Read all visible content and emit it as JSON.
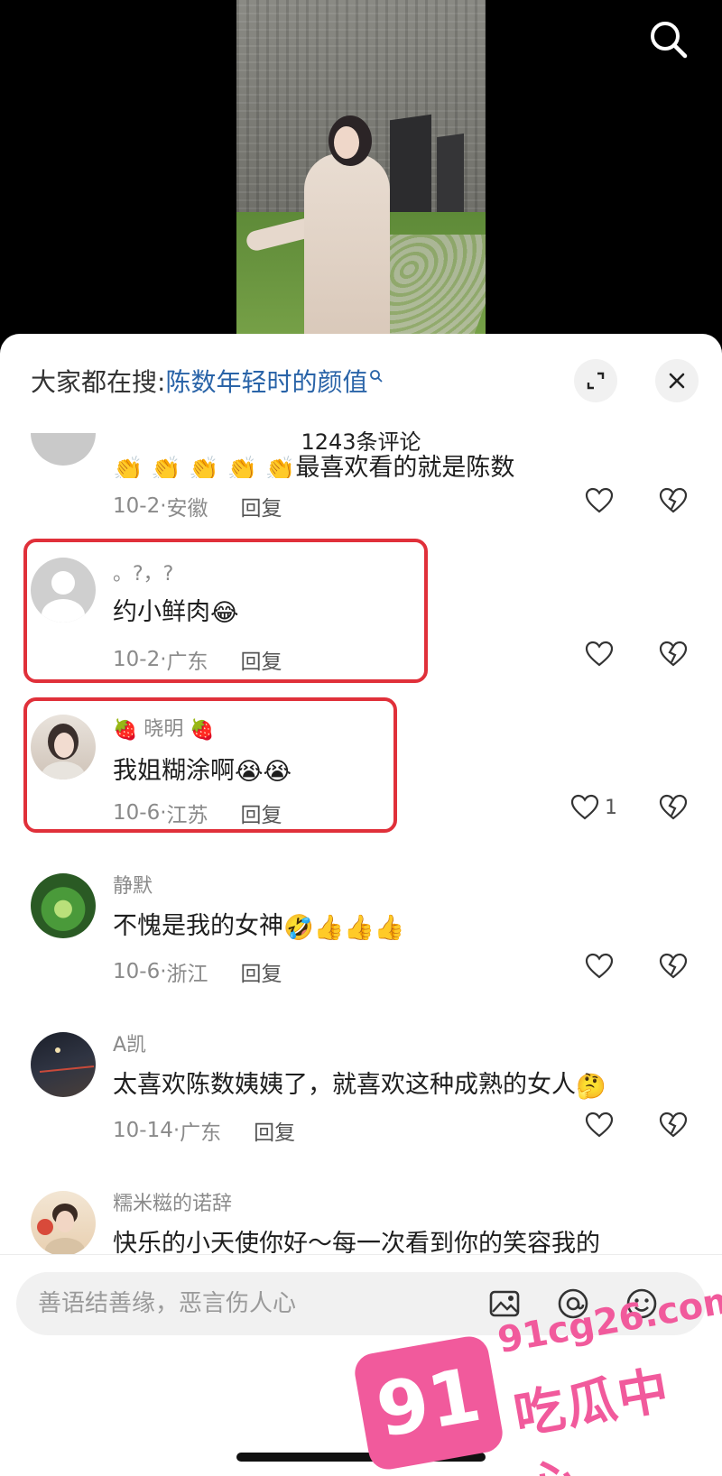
{
  "hot_search": {
    "label": "大家都在搜:",
    "query": "陈数年轻时的颜值"
  },
  "comment_count_label": "1243条评论",
  "partial_comment": {
    "text": "最喜欢看的就是陈数",
    "date": "10-2",
    "location": "安徽",
    "reply_label": "回复"
  },
  "comments": [
    {
      "username": "。?，?",
      "text": "约小鲜肉",
      "emoji": "😂",
      "date": "10-2",
      "location": "广东",
      "reply_label": "回复",
      "like_count": ""
    },
    {
      "username": "晓明",
      "username_emoji": "🍓",
      "text": "我姐糊涂啊",
      "emoji": "😭😭",
      "date": "10-6",
      "location": "江苏",
      "reply_label": "回复",
      "like_count": "1"
    },
    {
      "username": "静默",
      "text": "不愧是我的女神",
      "emoji": "🤣👍👍👍",
      "date": "10-6",
      "location": "浙江",
      "reply_label": "回复",
      "like_count": ""
    },
    {
      "username": "A凯",
      "text": "太喜欢陈数姨姨了，就喜欢这种成熟的女人",
      "emoji": "🤔",
      "date": "10-14",
      "location": "广东",
      "reply_label": "回复",
      "like_count": ""
    },
    {
      "username": "糯米糍的诺辞",
      "text": "快乐的小天使你好～每一次看到你的笑容我的",
      "emoji": "",
      "date": "",
      "location": "",
      "reply_label": "",
      "like_count": ""
    }
  ],
  "input": {
    "placeholder": "善语结善缘，恶言伤人心"
  },
  "watermark": {
    "badge": "91",
    "site": "91cg26.com",
    "name": "吃瓜中心"
  },
  "icons": {
    "top_search": "search-icon",
    "expand": "expand-icon",
    "close": "close-icon",
    "like": "heart-outline-icon",
    "dislike": "broken-heart-icon",
    "image": "image-icon",
    "mention": "at-icon",
    "emoji": "emoji-icon"
  },
  "colors": {
    "link_blue": "#2a64a8",
    "highlight_red": "#e0303a",
    "watermark_pink": "#f15a9c"
  }
}
